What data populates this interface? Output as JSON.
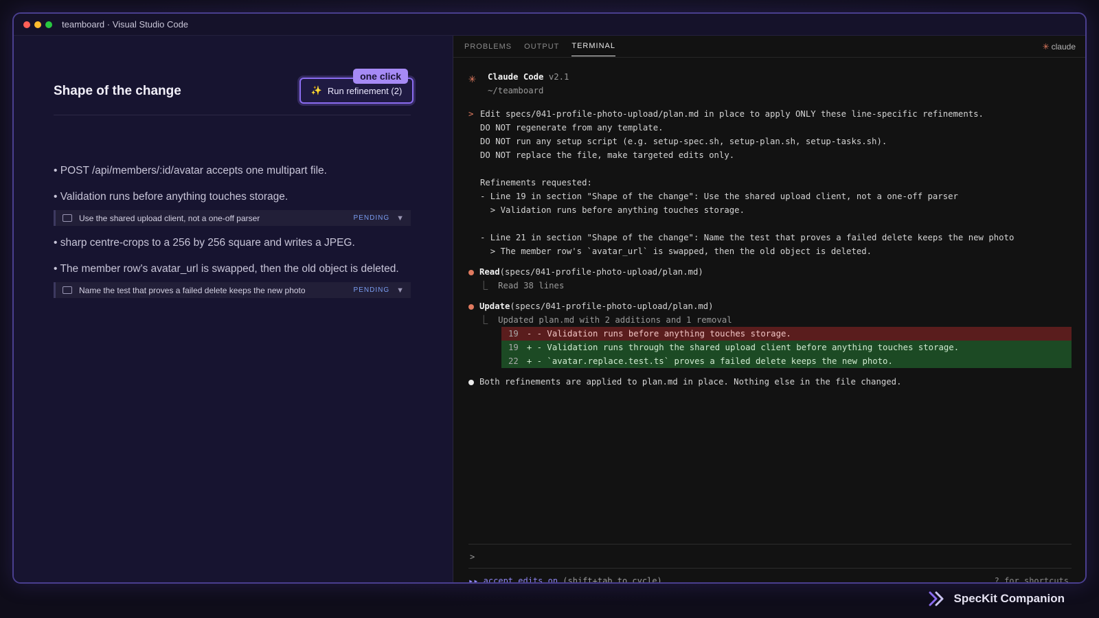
{
  "window": {
    "title": "teamboard · Visual Studio Code"
  },
  "spec": {
    "section_title": "Shape of the change",
    "run_button": "Run refinement (2)",
    "badge": "one click",
    "bullets": [
      "• POST /api/members/:id/avatar accepts one multipart file.",
      "• Validation runs before anything touches storage.",
      "• sharp centre-crops to a 256 by 256 square and writes a JPEG.",
      "• The member row's avatar_url is swapped, then the old object is deleted."
    ],
    "comments": [
      {
        "text": "Use the shared upload client, not a one-off parser",
        "status": "PENDING"
      },
      {
        "text": "Name the test that proves a failed delete keeps the new photo",
        "status": "PENDING"
      }
    ]
  },
  "panel": {
    "tabs": [
      "PROBLEMS",
      "OUTPUT",
      "TERMINAL"
    ],
    "active_tab": "TERMINAL",
    "session_label": "claude"
  },
  "terminal": {
    "app_name": "Claude Code",
    "version": "v2.1",
    "cwd": "~/teamboard",
    "prompt_lines": [
      "Edit specs/041-profile-photo-upload/plan.md in place to apply ONLY these line-specific refinements.",
      "DO NOT regenerate from any template.",
      "DO NOT run any setup script (e.g. setup-spec.sh, setup-plan.sh, setup-tasks.sh).",
      "DO NOT replace the file, make targeted edits only.",
      "",
      "Refinements requested:",
      "- Line 19 in section \"Shape of the change\": Use the shared upload client, not a one-off parser",
      "  > Validation runs before anything touches storage.",
      "",
      "- Line 21 in section \"Shape of the change\": Name the test that proves a failed delete keeps the new photo",
      "  > The member row's `avatar_url` is swapped, then the old object is deleted."
    ],
    "read_tool": "Read",
    "read_args": "(specs/041-profile-photo-upload/plan.md)",
    "read_result": "Read 38 lines",
    "update_tool": "Update",
    "update_args": "(specs/041-profile-photo-upload/plan.md)",
    "update_result": "Updated plan.md with 2 additions and 1 removal",
    "diff": [
      {
        "kind": "del",
        "num": "19",
        "sign": "-",
        "text": "- Validation runs before anything touches storage."
      },
      {
        "kind": "add",
        "num": "19",
        "sign": "+",
        "text": "- Validation runs through the shared upload client before anything touches storage."
      },
      {
        "kind": "add",
        "num": "22",
        "sign": "+",
        "text": "- `avatar.replace.test.ts` proves a failed delete keeps the new photo."
      }
    ],
    "final_message": "Both refinements are applied to plan.md in place. Nothing else in the file changed.",
    "input_prompt": ">",
    "accept_label": "▸▸ accept edits on",
    "accept_hint": "(shift+tab to cycle)",
    "shortcuts_hint": "? for shortcuts"
  },
  "brand": {
    "name": "SpecKit Companion"
  },
  "colors": {
    "accent": "#8b6cf0",
    "claude_orange": "#e07a5f",
    "diff_del": "#5a1d1d",
    "diff_add": "#1c4a24"
  }
}
